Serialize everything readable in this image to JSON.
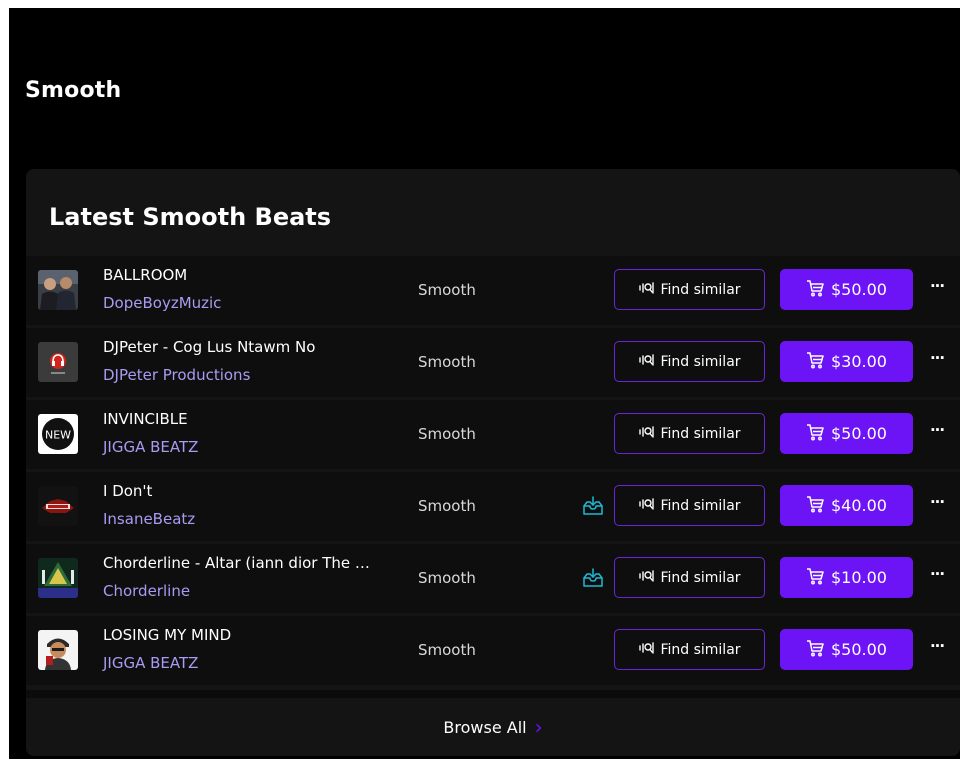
{
  "page": {
    "title": "Smooth"
  },
  "section": {
    "title": "Latest Smooth Beats",
    "browse_all": "Browse All"
  },
  "actions": {
    "find_similar": "Find similar",
    "more": "···"
  },
  "colors": {
    "accent": "#6c14f5",
    "producer_link": "#a99bf2",
    "free_download": "#1fb9d3"
  },
  "beats": [
    {
      "title": "BALLROOM",
      "producer": "DopeBoyzMuzic",
      "genre": "Smooth",
      "price": "$50.00",
      "free_download": false,
      "cover": "two-men-photo"
    },
    {
      "title": "DJPeter - Cog Lus Ntawm No",
      "producer": "DJPeter Productions",
      "genre": "Smooth",
      "price": "$30.00",
      "free_download": false,
      "cover": "headphones-logo"
    },
    {
      "title": "INVINCIBLE",
      "producer": "JIGGA BEATZ",
      "genre": "Smooth",
      "price": "$50.00",
      "free_download": false,
      "cover": "new-badge",
      "cover_text": "NEW"
    },
    {
      "title": "I Don't",
      "producer": "InsaneBeatz",
      "genre": "Smooth",
      "price": "$40.00",
      "free_download": true,
      "cover": "red-emblem"
    },
    {
      "title": "Chorderline - Altar (iann dior The …",
      "producer": "Chorderline",
      "genre": "Smooth",
      "price": "$10.00",
      "free_download": true,
      "cover": "album-art"
    },
    {
      "title": "LOSING MY MIND",
      "producer": "JIGGA BEATZ",
      "genre": "Smooth",
      "price": "$50.00",
      "free_download": false,
      "cover": "cartoon-avatar"
    }
  ]
}
